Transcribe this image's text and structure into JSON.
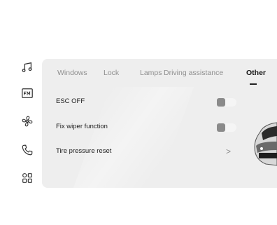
{
  "rail": {
    "icons": [
      "music-note-icon",
      "fm-radio-icon",
      "fan-icon",
      "phone-icon",
      "apps-grid-icon"
    ]
  },
  "tabs": [
    {
      "label": "Windows",
      "active": false
    },
    {
      "label": "Lock",
      "active": false
    },
    {
      "label": "Lamps",
      "active": false
    },
    {
      "label": "Driving assistance",
      "active": false
    },
    {
      "label": "Other",
      "active": true
    }
  ],
  "settings": [
    {
      "label": "ESC OFF",
      "control": "toggle",
      "on": false
    },
    {
      "label": "Fix wiper function",
      "control": "toggle",
      "on": false
    },
    {
      "label": "Tire pressure reset",
      "control": "chevron"
    }
  ],
  "colors": {
    "panel": "#eeeeee",
    "active_tab": "#151515",
    "inactive_tab": "#8f8f8f"
  }
}
